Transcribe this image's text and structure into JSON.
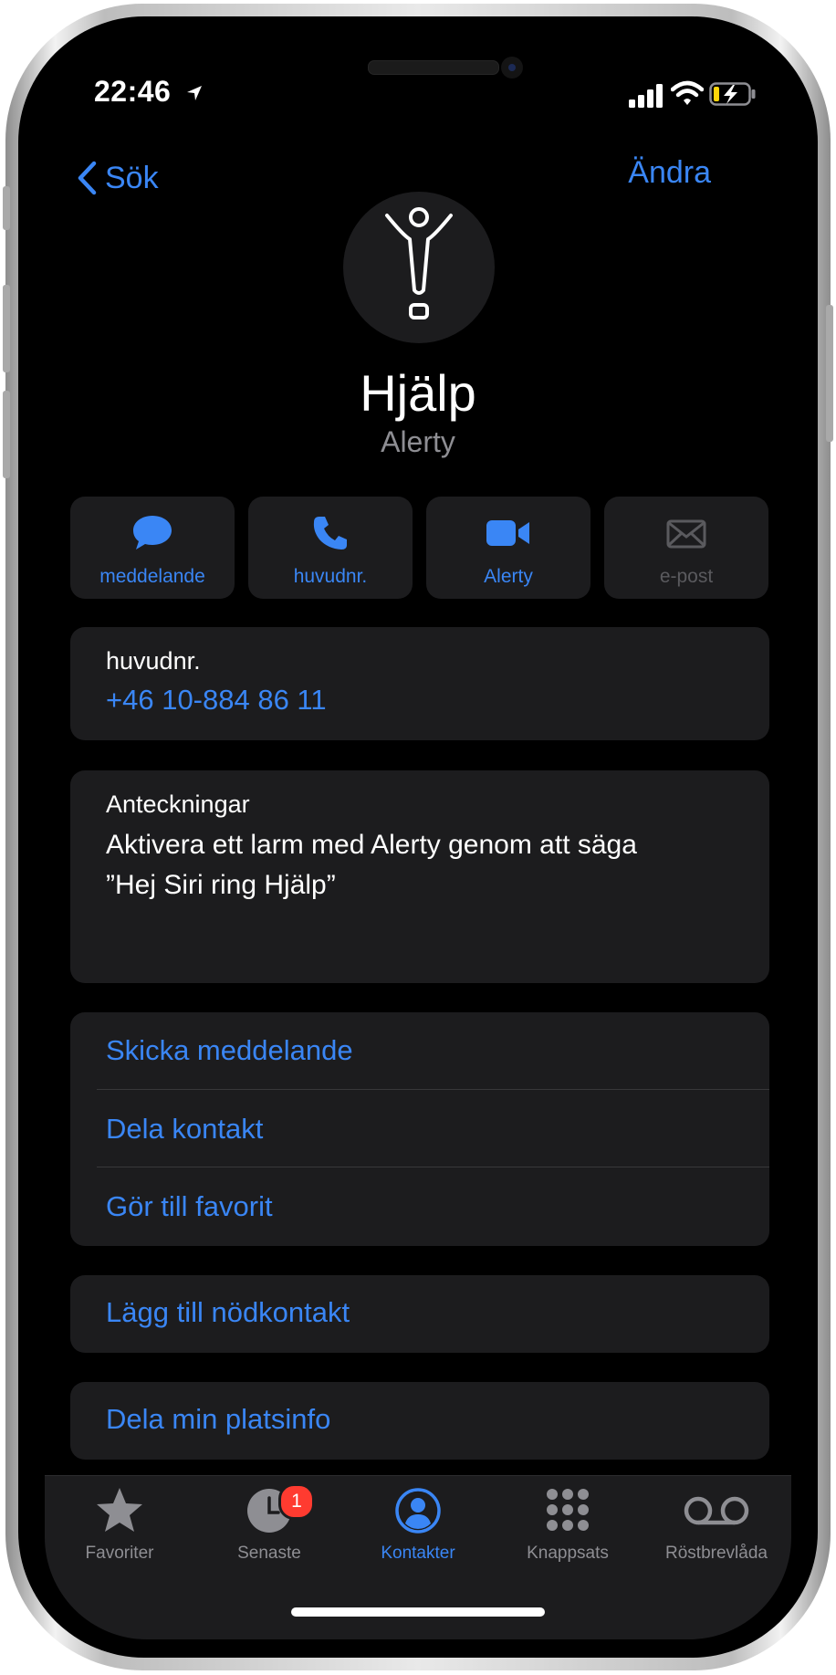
{
  "status": {
    "time": "22:46"
  },
  "nav": {
    "back_label": "Sök",
    "edit_label": "Ändra"
  },
  "contact": {
    "name": "Hjälp",
    "company": "Alerty"
  },
  "actions": [
    {
      "label": "meddelande",
      "icon": "message-icon",
      "enabled": true
    },
    {
      "label": "huvudnr.",
      "icon": "phone-icon",
      "enabled": true
    },
    {
      "label": "Alerty",
      "icon": "video-icon",
      "enabled": true
    },
    {
      "label": "e-post",
      "icon": "mail-icon",
      "enabled": false
    }
  ],
  "phone_card": {
    "label": "huvudnr.",
    "number": "+46 10-884 86 11"
  },
  "notes_card": {
    "label": "Anteckningar",
    "line1": "Aktivera ett larm med Alerty genom att säga",
    "line2": "”Hej Siri ring Hjälp”"
  },
  "options": [
    "Skicka meddelande",
    "Dela kontakt",
    "Gör till favorit"
  ],
  "emergency": {
    "label": "Lägg till nödkontakt"
  },
  "location": {
    "label": "Dela min platsinfo"
  },
  "tabs": [
    {
      "label": "Favoriter",
      "icon": "star-icon"
    },
    {
      "label": "Senaste",
      "icon": "clock-icon",
      "badge": "1"
    },
    {
      "label": "Kontakter",
      "icon": "contacts-icon",
      "active": true
    },
    {
      "label": "Knappsats",
      "icon": "keypad-icon"
    },
    {
      "label": "Röstbrevlåda",
      "icon": "voicemail-icon"
    }
  ],
  "colors": {
    "accent": "#3a86f5",
    "background": "#000000",
    "card": "#1c1c1e",
    "badge": "#ff3b30"
  }
}
